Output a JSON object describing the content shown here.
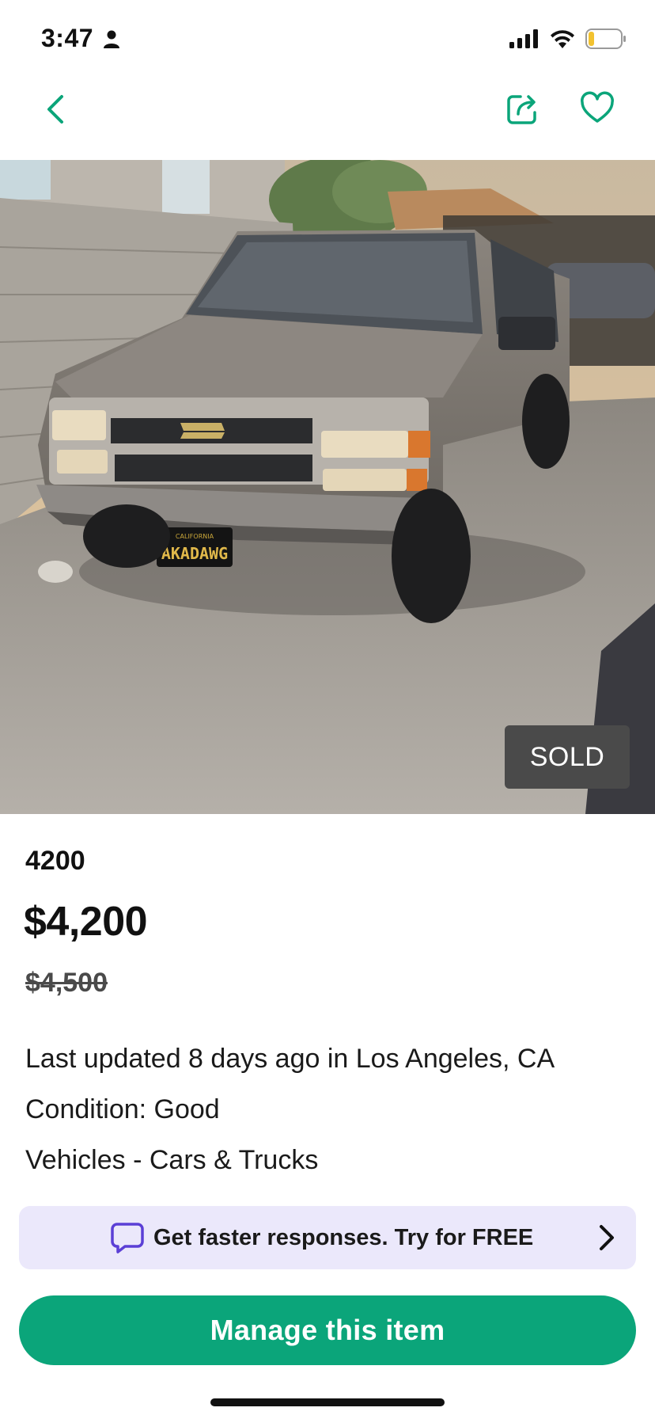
{
  "status_bar": {
    "time": "3:47"
  },
  "colors": {
    "accent": "#0ba57a",
    "promo_bg": "#ebe8fb",
    "promo_icon": "#5b3fd6",
    "sold_badge_bg": "#4a4a4a"
  },
  "icons": {
    "back": "chevron-left-icon",
    "share": "share-icon",
    "favorite": "heart-icon",
    "promo": "chat-bubble-icon",
    "promo_arrow": "chevron-right-icon"
  },
  "photo": {
    "badge": "SOLD",
    "plate_state": "CALIFORNIA",
    "plate_text": "AKADAWG"
  },
  "item": {
    "title": "4200",
    "price": "$4,200",
    "original_price": "$4,500",
    "updated": "Last updated 8 days ago in Los Angeles, CA",
    "condition": "Condition: Good",
    "category": "Vehicles - Cars & Trucks"
  },
  "promo": {
    "text": "Get faster responses.  Try for FREE"
  },
  "actions": {
    "manage_label": "Manage this item"
  }
}
